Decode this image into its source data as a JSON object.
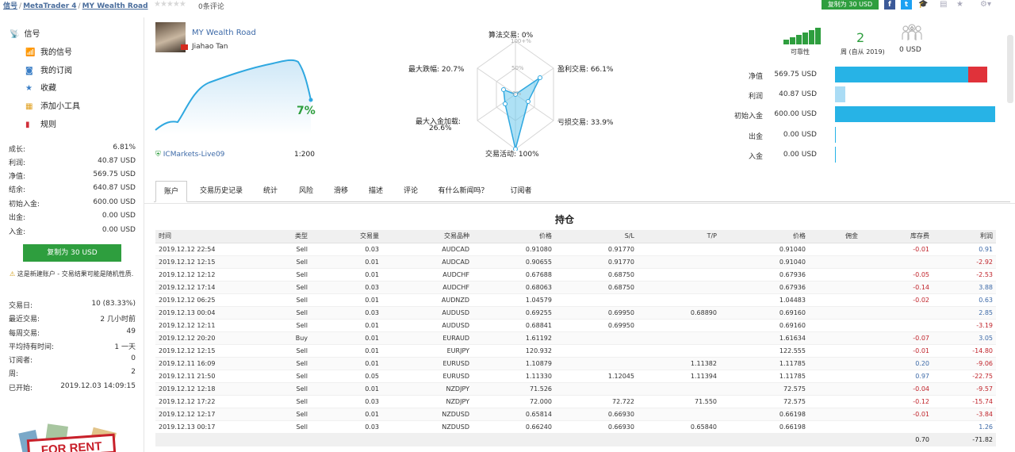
{
  "breadcrumb": {
    "part1": "信号",
    "part2": "MetaTrader 4",
    "part3": "MY Wealth Road",
    "sep": "/"
  },
  "reviews": "0条评论",
  "copy_top_label": "复制为 30 USD",
  "sidebar": {
    "header": "信号",
    "items": [
      "我的信号",
      "我的订阅",
      "收藏",
      "添加小工具",
      "规则"
    ],
    "stats": [
      {
        "label": "成长:",
        "value": "6.81%"
      },
      {
        "label": "利润:",
        "value": "40.87 USD"
      },
      {
        "label": "净值:",
        "value": "569.75 USD"
      },
      {
        "label": "结余:",
        "value": "640.87 USD"
      },
      {
        "label": "初始入金:",
        "value": "600.00 USD"
      },
      {
        "label": "出金:",
        "value": "0.00 USD"
      },
      {
        "label": "入金:",
        "value": "0.00 USD"
      }
    ],
    "copy_label": "复制为 30 USD",
    "warning": "这是新建账户 - 交易结果可能是随机性质.",
    "stats2": [
      {
        "label": "交易日:",
        "value": "10 (83.33%)"
      },
      {
        "label": "最近交易:",
        "value": "2 几小时前"
      },
      {
        "label": "每周交易:",
        "value": "49"
      },
      {
        "label": "平均持有时间:",
        "value": "1 一天"
      },
      {
        "label": "订阅者:",
        "value": "0"
      },
      {
        "label": "周:",
        "value": "2"
      },
      {
        "label": "已开始:",
        "value": "2019.12.03 14:09:15"
      }
    ],
    "rent_text": "FOR RENT"
  },
  "signal": {
    "name": "MY Wealth Road",
    "author": "Jiahao Tan",
    "growth": "7%",
    "broker": "ICMarkets-Live09",
    "leverage": "1:200"
  },
  "radar": {
    "algo": "算法交易: 0%",
    "profit": "盈利交易: 66.1%",
    "loss": "亏损交易: 33.9%",
    "activity": "交易活动: 100%",
    "deposit_load": "最大入金加载:",
    "deposit_load_v": "26.6%",
    "drawdown": "最大跌幅: 20.7%",
    "s100": "100+%",
    "s50": "50%",
    "s0": "0%"
  },
  "metrics": {
    "reliability": "可靠性",
    "weeks": "2",
    "weeks_label": "周 (自从 2019)",
    "subs": "0 USD",
    "subs_icon_count": "0"
  },
  "balances": [
    {
      "label": "净值",
      "value": "569.75 USD"
    },
    {
      "label": "利润",
      "value": "40.87 USD"
    },
    {
      "label": "初始入金",
      "value": "600.00 USD"
    },
    {
      "label": "出金",
      "value": "0.00 USD"
    },
    {
      "label": "入金",
      "value": "0.00 USD"
    }
  ],
  "tabs": [
    "账户",
    "交易历史记录",
    "统计",
    "风险",
    "滑移",
    "描述",
    "评论",
    "有什么新闻吗？",
    "订阅者"
  ],
  "positions": {
    "title": "持仓",
    "headers": [
      "时间",
      "类型",
      "交易量",
      "交易品种",
      "价格",
      "S/L",
      "T/P",
      "价格",
      "佣金",
      "库存费",
      "利润"
    ],
    "rows": [
      [
        "2019.12.12 22:54",
        "Sell",
        "0.03",
        "AUDCAD",
        "0.91080",
        "0.91770",
        "",
        "0.91040",
        "",
        "-0.01",
        "0.91"
      ],
      [
        "2019.12.12 12:15",
        "Sell",
        "0.01",
        "AUDCAD",
        "0.90655",
        "0.91770",
        "",
        "0.91040",
        "",
        "",
        "-2.92"
      ],
      [
        "2019.12.12 12:12",
        "Sell",
        "0.01",
        "AUDCHF",
        "0.67688",
        "0.68750",
        "",
        "0.67936",
        "",
        "-0.05",
        "-2.53"
      ],
      [
        "2019.12.12 17:14",
        "Sell",
        "0.03",
        "AUDCHF",
        "0.68063",
        "0.68750",
        "",
        "0.67936",
        "",
        "-0.14",
        "3.88"
      ],
      [
        "2019.12.12 06:25",
        "Sell",
        "0.01",
        "AUDNZD",
        "1.04579",
        "",
        "",
        "1.04483",
        "",
        "-0.02",
        "0.63"
      ],
      [
        "2019.12.13 00:04",
        "Sell",
        "0.03",
        "AUDUSD",
        "0.69255",
        "0.69950",
        "0.68890",
        "0.69160",
        "",
        "",
        "2.85"
      ],
      [
        "2019.12.12 12:11",
        "Sell",
        "0.01",
        "AUDUSD",
        "0.68841",
        "0.69950",
        "",
        "0.69160",
        "",
        "",
        "-3.19"
      ],
      [
        "2019.12.12 20:20",
        "Buy",
        "0.01",
        "EURAUD",
        "1.61192",
        "",
        "",
        "1.61634",
        "",
        "-0.07",
        "3.05"
      ],
      [
        "2019.12.12 12:15",
        "Sell",
        "0.01",
        "EURJPY",
        "120.932",
        "",
        "",
        "122.555",
        "",
        "-0.01",
        "-14.80"
      ],
      [
        "2019.12.11 16:09",
        "Sell",
        "0.01",
        "EURUSD",
        "1.10879",
        "",
        "1.11382",
        "1.11785",
        "",
        "0.20",
        "-9.06"
      ],
      [
        "2019.12.11 21:50",
        "Sell",
        "0.05",
        "EURUSD",
        "1.11330",
        "1.12045",
        "1.11394",
        "1.11785",
        "",
        "0.97",
        "-22.75"
      ],
      [
        "2019.12.12 12:18",
        "Sell",
        "0.01",
        "NZDJPY",
        "71.526",
        "",
        "",
        "72.575",
        "",
        "-0.04",
        "-9.57"
      ],
      [
        "2019.12.12 17:22",
        "Sell",
        "0.03",
        "NZDJPY",
        "72.000",
        "72.722",
        "71.550",
        "72.575",
        "",
        "-0.12",
        "-15.74"
      ],
      [
        "2019.12.12 12:17",
        "Sell",
        "0.01",
        "NZDUSD",
        "0.65814",
        "0.66930",
        "",
        "0.66198",
        "",
        "-0.01",
        "-3.84"
      ],
      [
        "2019.12.13 00:17",
        "Sell",
        "0.03",
        "NZDUSD",
        "0.66240",
        "0.66930",
        "0.65840",
        "0.66198",
        "",
        "",
        "1.26"
      ]
    ],
    "total_swap": "0.70",
    "total_profit": "-71.82"
  },
  "colors": {
    "green": "#2e9e3e",
    "blue": "#3d6aa8",
    "bar_blue": "#27b3e6",
    "bar_light": "#aadcf5",
    "bar_red": "#e0323a",
    "neg": "#c0232a"
  }
}
